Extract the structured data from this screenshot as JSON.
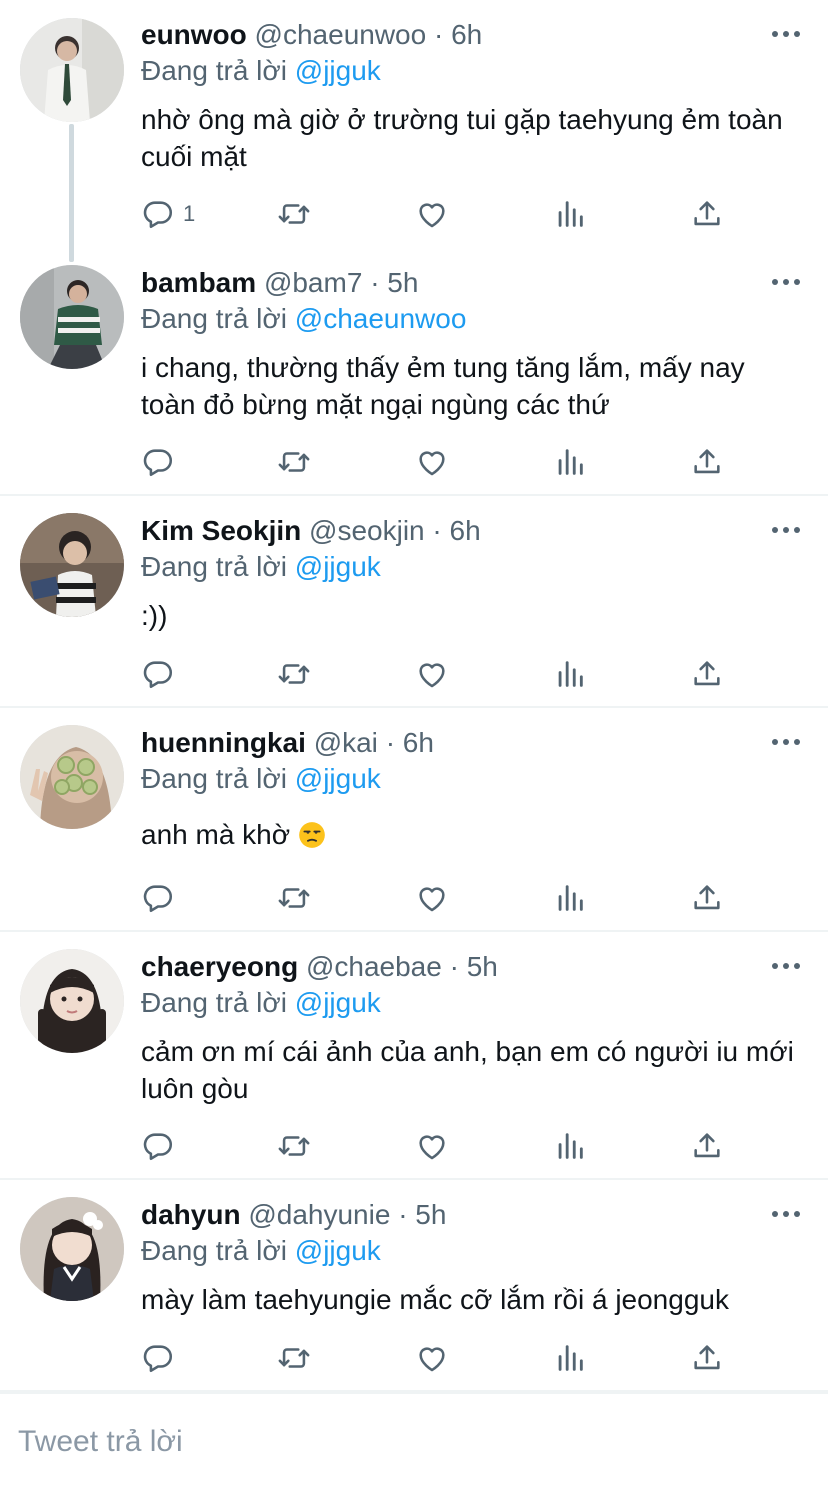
{
  "colors": {
    "accent": "#1d9bf0",
    "secondary_text": "#536471",
    "divider": "#eff3f4",
    "thread_line": "#cfd9de"
  },
  "icons": {
    "reply": "comment-bubble-icon",
    "retweet": "retweet-icon",
    "like": "heart-icon",
    "views": "bar-chart-icon",
    "share": "share-upload-icon",
    "more": "more-dots-icon"
  },
  "tweets": [
    {
      "name": "eunwoo",
      "handle": "@chaeunwoo",
      "time": "· 6h",
      "replying_label": "Đang trả lời",
      "replying_to": "@jjguk",
      "text": "nhờ ông mà giờ ở trường tui gặp taehyung ẻm toàn cuối mặt",
      "reply_count": "1"
    },
    {
      "name": "bambam",
      "handle": "@bam7",
      "time": "· 5h",
      "replying_label": "Đang trả lời",
      "replying_to": "@chaeunwoo",
      "text": "i chang, thường thấy ẻm tung tăng lắm, mấy nay toàn đỏ bừng mặt ngại ngùng các thứ",
      "reply_count": ""
    },
    {
      "name": "Kim Seokjin",
      "handle": "@seokjin",
      "time": "· 6h",
      "replying_label": "Đang trả lời",
      "replying_to": "@jjguk",
      "text": ":))",
      "reply_count": ""
    },
    {
      "name": "huenningkai",
      "handle": "@kai",
      "time": "· 6h",
      "replying_label": "Đang trả lời",
      "replying_to": "@jjguk",
      "text": "anh mà khờ",
      "reply_count": ""
    },
    {
      "name": "chaeryeong",
      "handle": "@chaebae",
      "time": "· 5h",
      "replying_label": "Đang trả lời",
      "replying_to": "@jjguk",
      "text": "cảm ơn mí cái ảnh của anh, bạn em có người iu mới luôn gòu",
      "reply_count": ""
    },
    {
      "name": "dahyun",
      "handle": "@dahyunie",
      "time": "· 5h",
      "replying_label": "Đang trả lời",
      "replying_to": "@jjguk",
      "text": "mày làm taehyungie mắc cỡ lắm rồi á jeongguk",
      "reply_count": ""
    }
  ],
  "reply_bar": {
    "placeholder": "Tweet trả lời"
  }
}
